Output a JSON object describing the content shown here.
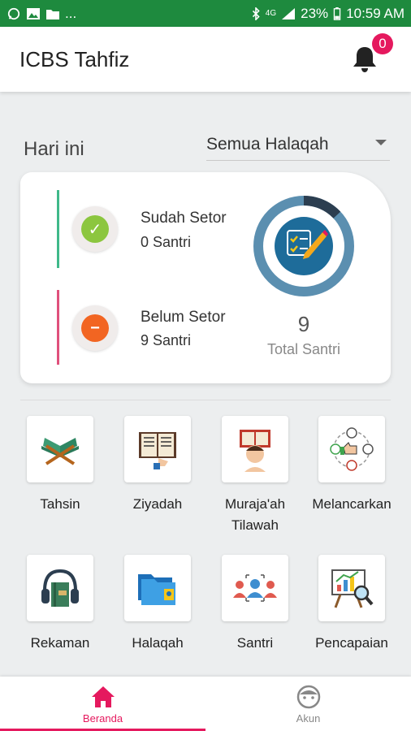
{
  "statusbar": {
    "dots": "...",
    "network": "4G",
    "battery": "23%",
    "time": "10:59 AM"
  },
  "appbar": {
    "title": "ICBS Tahfiz",
    "notification_count": "0"
  },
  "filter": {
    "today_label": "Hari ini",
    "halaqah_selected": "Semua Halaqah"
  },
  "summary": {
    "done_title": "Sudah Setor",
    "done_count": "0 Santri",
    "pending_title": "Belum Setor",
    "pending_count": "9 Santri",
    "total": "9",
    "total_label": "Total Santri",
    "progress_fraction": 0.13
  },
  "menu": [
    {
      "label": "Tahsin",
      "icon": "quran-stand-icon"
    },
    {
      "label": "Ziyadah",
      "icon": "open-book-icon"
    },
    {
      "label": "Muraja'ah Tilawah",
      "icon": "reading-person-icon"
    },
    {
      "label": "Melancarkan",
      "icon": "feedback-cycle-icon"
    },
    {
      "label": "Rekaman",
      "icon": "headphones-book-icon"
    },
    {
      "label": "Halaqah",
      "icon": "folder-icon"
    },
    {
      "label": "Santri",
      "icon": "students-icon"
    },
    {
      "label": "Pencapaian",
      "icon": "chart-board-icon"
    }
  ],
  "bottom_nav": {
    "home": "Beranda",
    "account": "Akun"
  },
  "colors": {
    "statusbar": "#1e8a3e",
    "accent": "#e5195e",
    "done": "#8cc63f",
    "pending": "#f26522",
    "donut": "#5b8fb0"
  }
}
